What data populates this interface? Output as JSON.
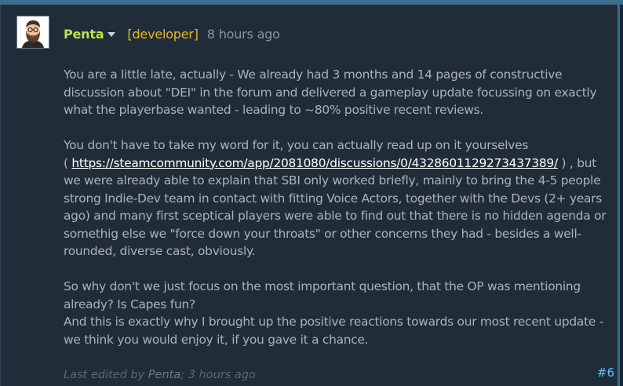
{
  "post": {
    "author": "Penta",
    "role": "[developer]",
    "timestamp": "8 hours ago",
    "paragraphs": [
      [
        "You are a little late, actually - We already had 3 months and 14 pages of constructive",
        "discussion about \"DEI\" in the forum and delivered a gameplay update focussing on exactly",
        "what the playerbase wanted - leading to ~80% positive recent reviews."
      ],
      {
        "line1": "You don't have to take my word for it, you can actually read up on it yourselves",
        "line2_prefix": "( ",
        "link": "https://steamcommunity.com/app/2081080/discussions/0/4328601129273437389/",
        "line2_suffix": " ) , but",
        "rest": [
          "we were already able to explain that SBI only worked briefly, mainly to bring the 4-5 people",
          "strong Indie-Dev team in contact with fitting Voice Actors, together with the Devs (2+ years",
          "ago) and many first sceptical players were able to find out that there is no hidden agenda or",
          "somethig else we \"force down your throats\" or other concerns they had - besides a well-",
          "rounded, diverse cast, obviously."
        ]
      },
      [
        "So why don't we just focus on the most important question, that the OP was mentioning",
        "already? Is Capes fun?",
        "And this is exactly why I brought up the positive reactions towards our most recent update -",
        "we think you would enjoy it, if you gave it a chance."
      ]
    ],
    "edit_note": {
      "prefix": "Last edited by ",
      "editor": "Penta",
      "suffix": "; 3 hours ago"
    },
    "post_number": "#6"
  },
  "colors": {
    "author": "#b7e349",
    "role": "#e8b525",
    "link": "#ffffff",
    "body_text": "#acb2b8",
    "post_number": "#67c1f5"
  }
}
